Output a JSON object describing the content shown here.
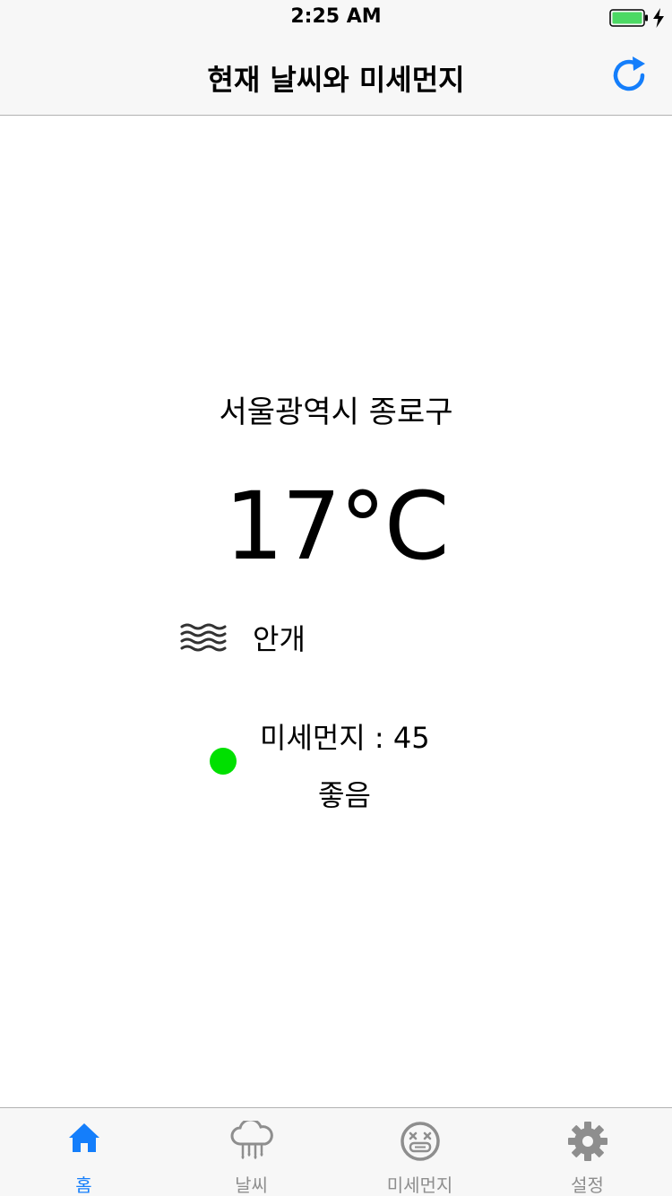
{
  "status_bar": {
    "time": "2:25 AM"
  },
  "nav": {
    "title": "현재 날씨와 미세먼지",
    "refresh_icon": "refresh-icon"
  },
  "weather": {
    "location": "서울광역시 종로구",
    "temperature": "17°C",
    "condition_icon": "fog-icon",
    "condition": "안개"
  },
  "dust": {
    "value_text": "미세먼지 : 45",
    "grade": "좋음",
    "indicator_color": "#00e000"
  },
  "tabs": [
    {
      "label": "홈",
      "icon": "home-icon",
      "active": true
    },
    {
      "label": "날씨",
      "icon": "rain-cloud-icon",
      "active": false
    },
    {
      "label": "미세먼지",
      "icon": "dust-face-icon",
      "active": false
    },
    {
      "label": "설정",
      "icon": "gear-icon",
      "active": false
    }
  ],
  "colors": {
    "accent": "#147efb",
    "inactive": "#8e8e8e",
    "battery": "#4cd964"
  }
}
